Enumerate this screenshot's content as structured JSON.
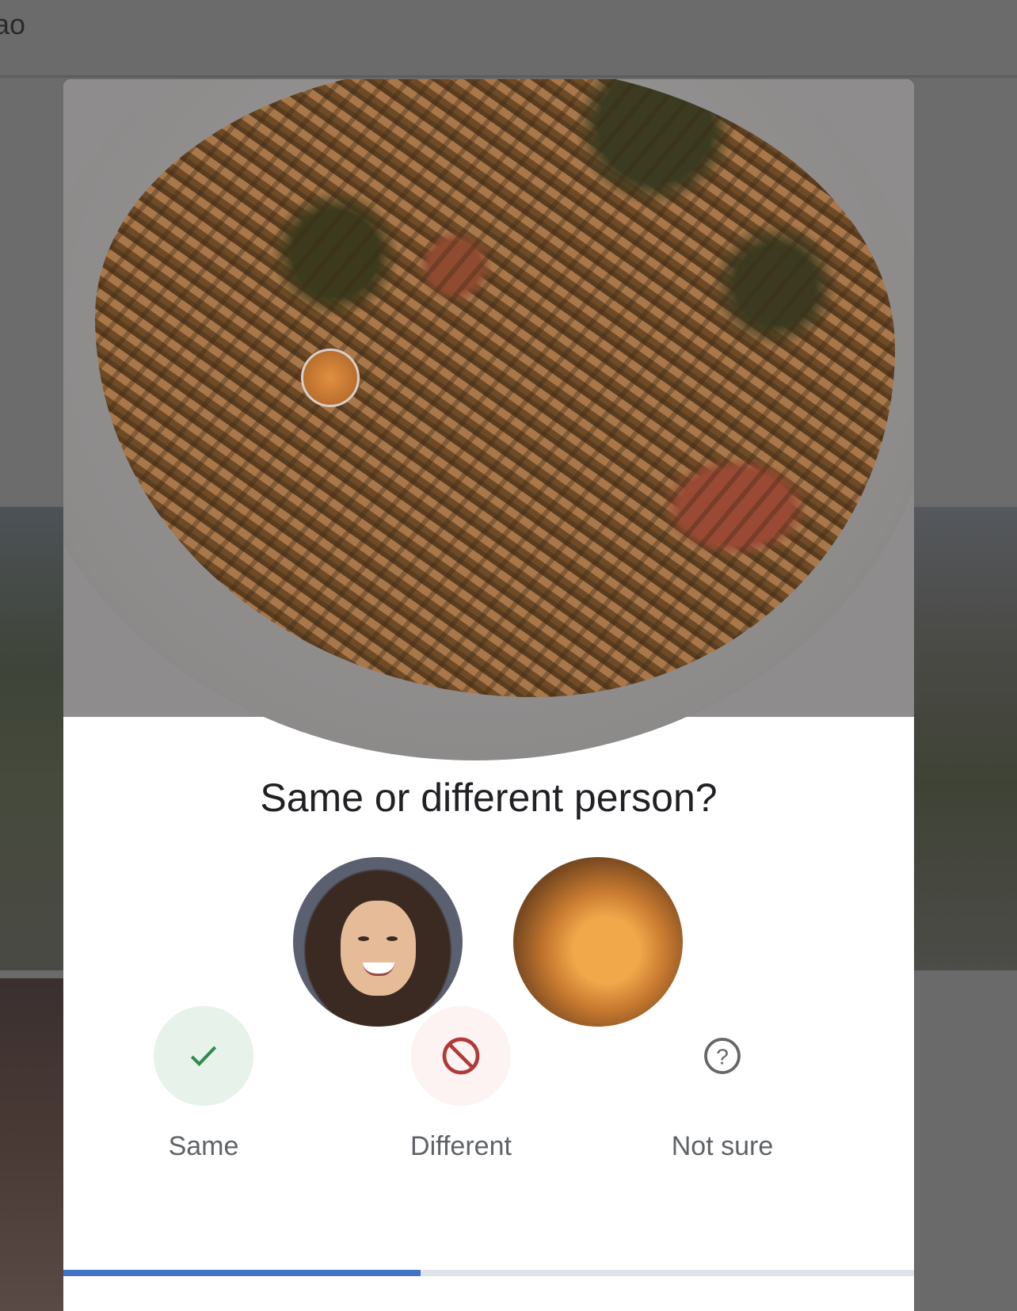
{
  "header": {
    "partial_name": "ao"
  },
  "dialog": {
    "title": "Same or different person?",
    "actions": [
      {
        "label": "Same",
        "icon": "check-icon",
        "color": "#34a853"
      },
      {
        "label": "Different",
        "icon": "block-icon",
        "color": "#c5221f"
      },
      {
        "label": "Not sure",
        "icon": "help-circle-icon",
        "color": "#5f6368"
      }
    ],
    "progress_percent": 42
  }
}
